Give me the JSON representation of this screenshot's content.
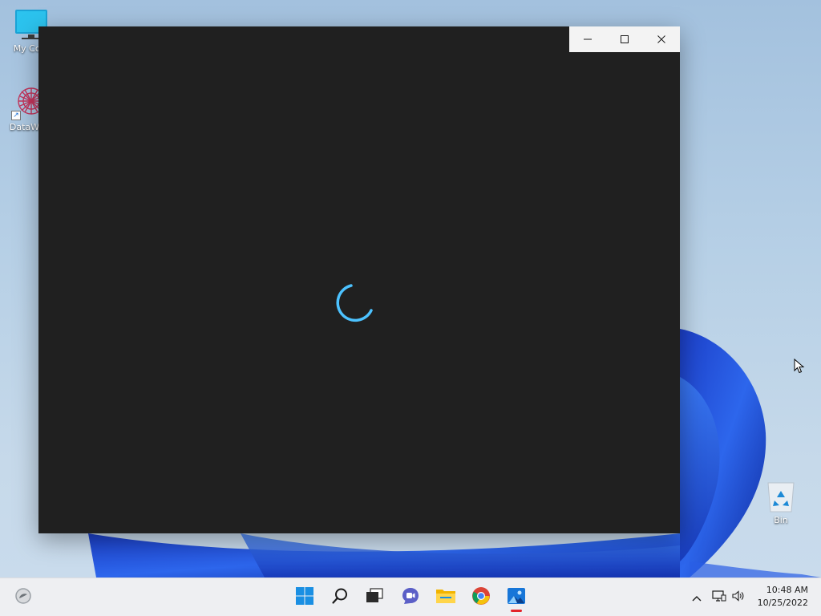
{
  "desktop": {
    "icons": [
      {
        "label": "My Com",
        "icon": "monitor-icon"
      },
      {
        "label": "DataWag",
        "icon": "datawag-app-icon"
      },
      {
        "label": "Bin",
        "icon": "recycle-bin-icon"
      }
    ]
  },
  "window": {
    "caption": {
      "minimize_icon": "minimize-icon",
      "maximize_icon": "maximize-icon",
      "close_icon": "close-icon"
    },
    "content": {
      "state_icon": "loading-spinner-icon",
      "accent": "#4cc2ff"
    }
  },
  "taskbar": {
    "left_widget_icon": "weather-widget-icon",
    "pinned": [
      {
        "icon": "windows-start-icon"
      },
      {
        "icon": "search-icon"
      },
      {
        "icon": "task-view-icon"
      },
      {
        "icon": "chat-icon"
      },
      {
        "icon": "file-explorer-icon"
      },
      {
        "icon": "chrome-icon"
      },
      {
        "icon": "photos-icon",
        "active": true
      }
    ],
    "tray": {
      "icons": [
        "chevron-up-icon",
        "network-icon",
        "volume-icon"
      ],
      "time": "10:48 AM",
      "date": "10/25/2022"
    },
    "active_indicator_color": "#e3242b"
  },
  "colors": {
    "window_bg": "#202020",
    "caption_bg": "#f3f3f3",
    "wallpaper_accent": "#1f4fd6"
  }
}
